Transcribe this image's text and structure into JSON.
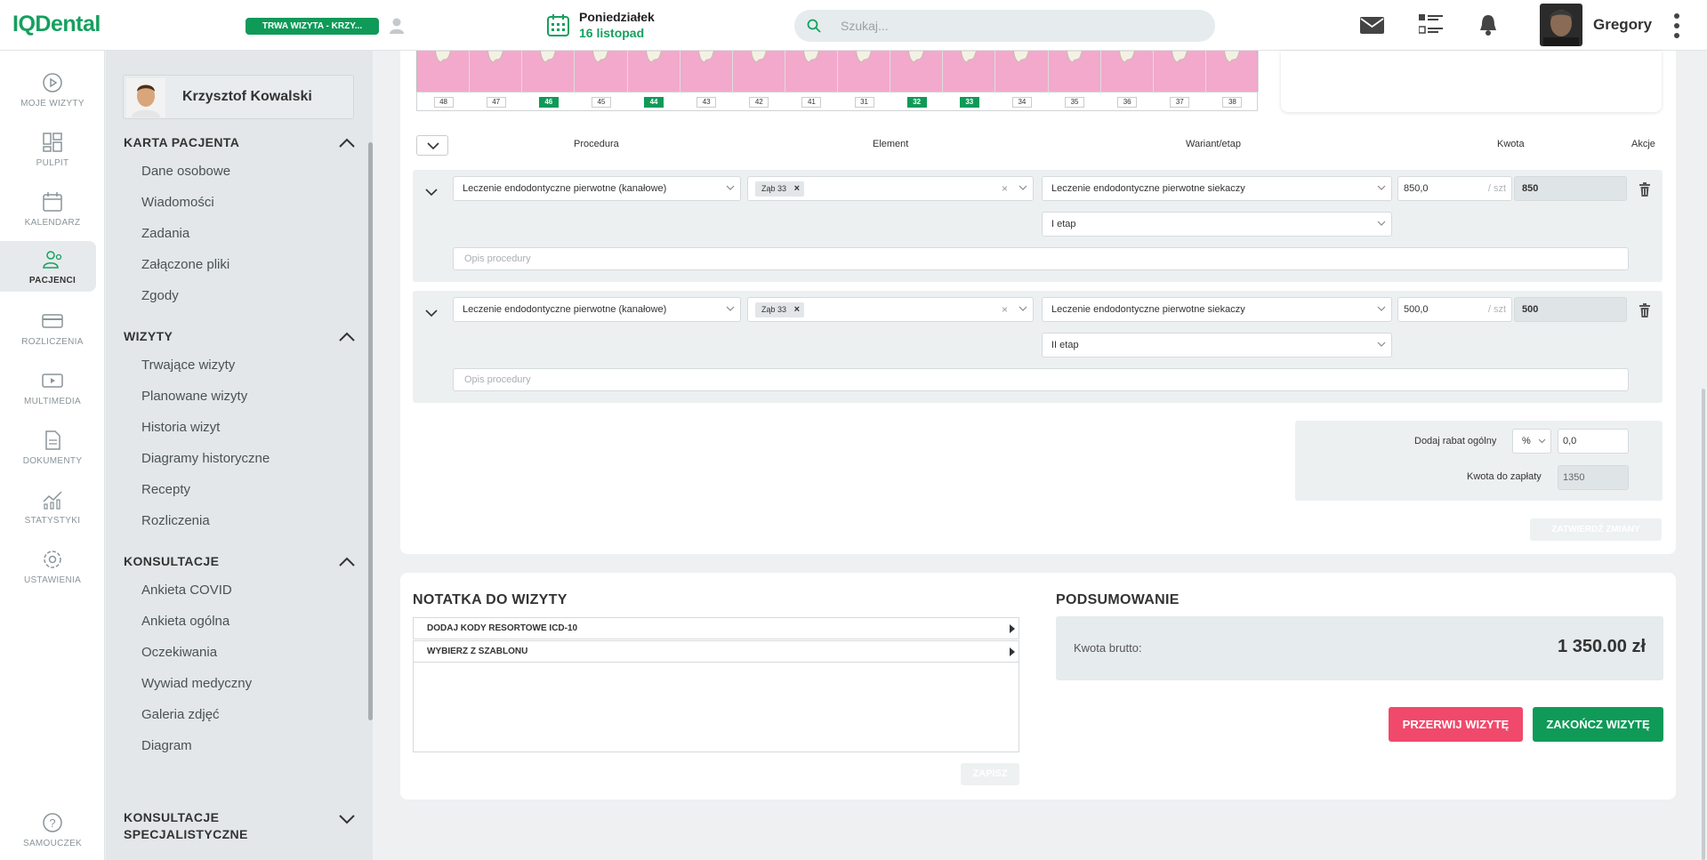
{
  "app": {
    "logo": "IQDental"
  },
  "header": {
    "visit_badge": "TRWA WIZYTA - KRZY...",
    "date_day": "Poniedziałek",
    "date_date": "16 listopad",
    "search_placeholder": "Szukaj...",
    "user_name": "Gregory",
    "icons": [
      "mail-icon",
      "list-view-icon",
      "bell-icon",
      "kebab-menu-icon"
    ]
  },
  "leftnav": {
    "items": [
      {
        "label": "MOJE WIZYTY",
        "icon": "play-circle-icon"
      },
      {
        "label": "PULPIT",
        "icon": "dashboard-icon"
      },
      {
        "label": "KALENDARZ",
        "icon": "calendar-icon"
      },
      {
        "label": "PACJENCI",
        "icon": "patients-icon",
        "active": true
      },
      {
        "label": "ROZLICZENIA",
        "icon": "card-icon"
      },
      {
        "label": "MULTIMEDIA",
        "icon": "multimedia-icon"
      },
      {
        "label": "DOKUMENTY",
        "icon": "document-icon"
      },
      {
        "label": "STATYSTYKI",
        "icon": "stats-icon"
      },
      {
        "label": "USTAWIENIA",
        "icon": "gear-icon"
      }
    ],
    "help": "SAMOUCZEK"
  },
  "patient": {
    "name": "Krzysztof Kowalski",
    "sections": [
      {
        "title": "KARTA PACJENTA",
        "expanded": true,
        "items": [
          "Dane osobowe",
          "Wiadomości",
          "Zadania",
          "Załączone pliki",
          "Zgody"
        ]
      },
      {
        "title": "WIZYTY",
        "expanded": true,
        "items": [
          "Trwające wizyty",
          "Planowane wizyty",
          "Historia wizyt",
          "Diagramy historyczne",
          "Recepty",
          "Rozliczenia"
        ]
      },
      {
        "title": "KONSULTACJE",
        "expanded": true,
        "items": [
          "Ankieta COVID",
          "Ankieta ogólna",
          "Oczekiwania",
          "Wywiad medyczny",
          "Galeria zdjęć",
          "Diagram"
        ]
      },
      {
        "title_line1": "KONSULTACJE",
        "title_line2": "SPECJALISTYCZNE",
        "expanded": false
      }
    ]
  },
  "teeth": {
    "numbers": [
      "48",
      "47",
      "46",
      "45",
      "44",
      "43",
      "42",
      "41",
      "31",
      "32",
      "33",
      "34",
      "35",
      "36",
      "37",
      "38"
    ],
    "selected": [
      "46",
      "44",
      "32",
      "33"
    ]
  },
  "procedures": {
    "columns": {
      "procedure": "Procedura",
      "element": "Element",
      "variant": "Wariant/etap",
      "amount": "Kwota",
      "actions": "Akcje"
    },
    "rows": [
      {
        "procedure": "Leczenie endodontyczne pierwotne (kanałowe)",
        "element_chip": "Ząb 33",
        "variant": "Leczenie endodontyczne pierwotne siekaczy",
        "stage": "I etap",
        "price": "850,0",
        "unit": "/ szt",
        "total": "850",
        "desc_placeholder": "Opis procedury"
      },
      {
        "procedure": "Leczenie endodontyczne pierwotne (kanałowe)",
        "element_chip": "Ząb 33",
        "variant": "Leczenie endodontyczne pierwotne siekaczy",
        "stage": "II etap",
        "price": "500,0",
        "unit": "/ szt",
        "total": "500",
        "desc_placeholder": "Opis procedury"
      }
    ],
    "discount_label": "Dodaj rabat ogólny",
    "discount_type": "%",
    "discount_value": "0,0",
    "to_pay_label": "Kwota do zapłaty",
    "to_pay_value": "1350",
    "confirm_label": "ZATWIERDŹ ZMIANY"
  },
  "note": {
    "title": "NOTATKA DO WIZYTY",
    "option1": "DODAJ KODY RESORTOWE ICD-10",
    "option2": "WYBIERZ Z SZABLONU",
    "save_label": "ZAPISZ"
  },
  "summary": {
    "title": "PODSUMOWANIE",
    "gross_label": "Kwota brutto:",
    "gross_value": "1 350.00 zł",
    "break_label": "PRZERWIJ WIZYTĘ",
    "finish_label": "ZAKOŃCZ WIZYTĘ"
  },
  "colors": {
    "brand": "#15a05f",
    "danger": "#f0496b",
    "teeth_bg": "#f2a9cc"
  }
}
